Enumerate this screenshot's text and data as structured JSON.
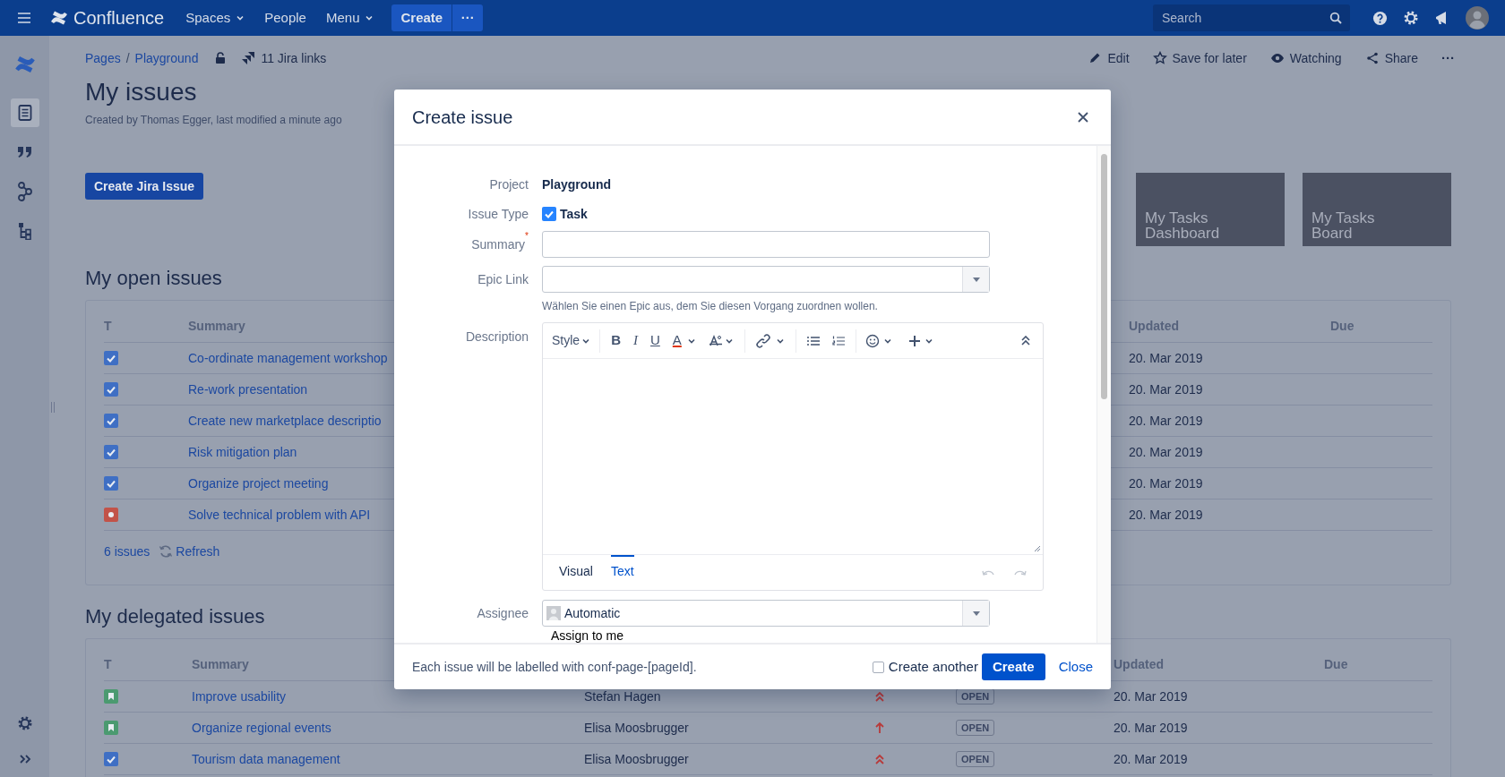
{
  "top_nav": {
    "logo": "Confluence",
    "menu_items": [
      {
        "label": "Spaces",
        "dropdown": true
      },
      {
        "label": "People",
        "dropdown": false
      },
      {
        "label": "Menu",
        "dropdown": true
      }
    ],
    "create_button": "Create",
    "more_button": "···",
    "search": {
      "placeholder": "Search"
    }
  },
  "sidebar": {
    "items": [
      {
        "kind": "pages",
        "selected": true
      },
      {
        "kind": "blog",
        "selected": false
      },
      {
        "kind": "graph",
        "selected": false
      },
      {
        "kind": "tree",
        "selected": false
      }
    ]
  },
  "breadcrumbs": {
    "items": [
      "Pages",
      "Playground"
    ],
    "separator": "/",
    "jira_links": "11 Jira links"
  },
  "page_actions": [
    {
      "kind": "edit",
      "label": "Edit"
    },
    {
      "kind": "save",
      "label": "Save for later"
    },
    {
      "kind": "watch",
      "label": "Watching"
    },
    {
      "kind": "share",
      "label": "Share"
    }
  ],
  "page_more": "···",
  "page": {
    "title": "My issues",
    "byline": "Created by Thomas Egger, last modified a minute ago",
    "create_button": "Create Jira Issue",
    "tiles": [
      "My Tasks Dashboard",
      "My Tasks Board"
    ]
  },
  "open_issues": {
    "heading": "My open issues",
    "columns": [
      "T",
      "Summary",
      "Updated",
      "Due"
    ],
    "rows": [
      {
        "kind": "task",
        "summary": "Co-ordinate management workshop",
        "updated": "20. Mar 2019"
      },
      {
        "kind": "task",
        "summary": "Re-work presentation",
        "updated": "20. Mar 2019"
      },
      {
        "kind": "task",
        "summary": "Create new marketplace descriptio",
        "updated": "20. Mar 2019"
      },
      {
        "kind": "task",
        "summary": "Risk mitigation plan",
        "updated": "20. Mar 2019"
      },
      {
        "kind": "task",
        "summary": "Organize project meeting",
        "updated": "20. Mar 2019"
      },
      {
        "kind": "bug",
        "summary": "Solve technical problem with API",
        "updated": "20. Mar 2019"
      }
    ],
    "count": "6 issues",
    "refresh": "Refresh"
  },
  "delegated_issues": {
    "heading": "My delegated issues",
    "columns": [
      "T",
      "Summary",
      "Updated",
      "Due"
    ],
    "rows": [
      {
        "kind": "story",
        "summary": "Improve usability",
        "assignee": "Stefan Hagen",
        "priority": {
          "kind": "highest"
        },
        "status": "OPEN",
        "updated": "20. Mar 2019"
      },
      {
        "kind": "story",
        "summary": "Organize regional events",
        "assignee": "Elisa Moosbrugger",
        "priority": {
          "kind": "high"
        },
        "status": "OPEN",
        "updated": "20. Mar 2019"
      },
      {
        "kind": "task",
        "summary": "Tourism data management",
        "assignee": "Elisa Moosbrugger",
        "priority": {
          "kind": "highest"
        },
        "status": "OPEN",
        "updated": "20. Mar 2019"
      }
    ]
  },
  "dialog": {
    "title": "Create issue",
    "fields": [
      {
        "kind": "value",
        "label": "Project",
        "value": "Playground"
      },
      {
        "kind": "issue-type",
        "label": "Issue Type",
        "value": "Task"
      },
      {
        "kind": "input",
        "label": "Summary",
        "required_mark": "*"
      },
      {
        "kind": "select",
        "label": "Epic Link",
        "hint": "Wählen Sie einen Epic aus, dem Sie diesen Vorgang zuordnen wollen."
      },
      {
        "kind": "editor",
        "label": "Description",
        "style_button": "Style",
        "format_buttons": [
          {
            "kind": "bold",
            "glyph": "B"
          },
          {
            "kind": "italic",
            "glyph": "I"
          },
          {
            "kind": "underline",
            "glyph": "U"
          },
          {
            "kind": "color",
            "glyph": "A"
          }
        ],
        "tabs": [
          {
            "label": "Visual",
            "selected": false
          },
          {
            "label": "Text",
            "selected": true
          }
        ]
      },
      {
        "kind": "user-select",
        "label": "Assignee",
        "value": "Automatic",
        "link": "Assign to me"
      }
    ],
    "footer_note": "Each issue will be labelled with conf-page-[pageId].",
    "create_another": {
      "label": "Create another",
      "checked": false
    },
    "create_button": "Create",
    "close_button": "Close"
  }
}
